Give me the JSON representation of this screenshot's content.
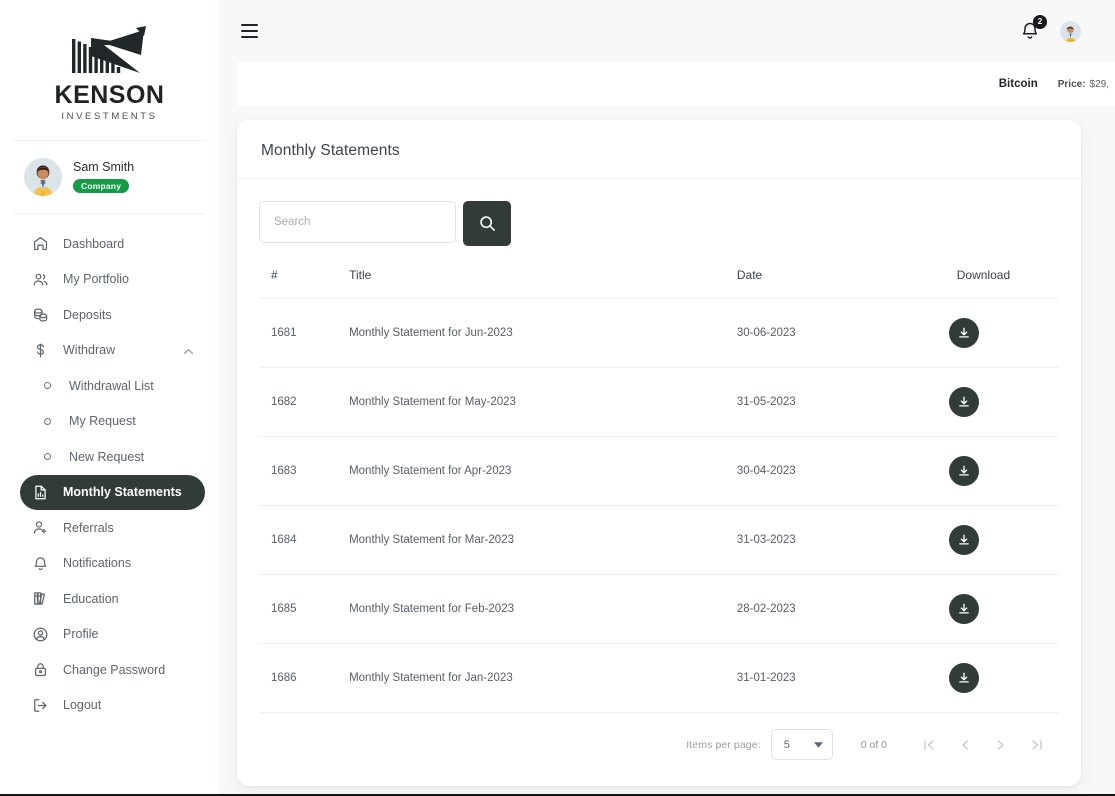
{
  "brand": {
    "name": "KENSON",
    "tagline": "INVESTMENTS",
    "logo_icon": "kenson-arrow-bars-logo"
  },
  "user": {
    "name": "Sam Smith",
    "badge": "Company",
    "badge_color": "#149b45",
    "avatar_icon": "user-avatar"
  },
  "sidebar": {
    "items": [
      {
        "label": "Dashboard",
        "icon": "home-icon",
        "active": false,
        "sub": false
      },
      {
        "label": "My Portfolio",
        "icon": "users-icon",
        "active": false,
        "sub": false
      },
      {
        "label": "Deposits",
        "icon": "coins-icon",
        "active": false,
        "sub": false
      },
      {
        "label": "Withdraw",
        "icon": "dollar-icon",
        "active": false,
        "sub": false,
        "chevron": "chevron-up-icon"
      },
      {
        "label": "Withdrawal List",
        "icon": "bullet-icon",
        "active": false,
        "sub": true
      },
      {
        "label": "My Request",
        "icon": "bullet-icon",
        "active": false,
        "sub": true
      },
      {
        "label": "New Request",
        "icon": "bullet-icon",
        "active": false,
        "sub": true
      },
      {
        "label": "Monthly Statements",
        "icon": "document-chart-icon",
        "active": true,
        "sub": false
      },
      {
        "label": "Referrals",
        "icon": "user-add-icon",
        "active": false,
        "sub": false
      },
      {
        "label": "Notifications",
        "icon": "bell-icon",
        "active": false,
        "sub": false
      },
      {
        "label": "Education",
        "icon": "books-icon",
        "active": false,
        "sub": false
      },
      {
        "label": "Profile",
        "icon": "user-circle-icon",
        "active": false,
        "sub": false
      },
      {
        "label": "Change Password",
        "icon": "lock-icon",
        "active": false,
        "sub": false
      },
      {
        "label": "Logout",
        "icon": "logout-icon",
        "active": false,
        "sub": false
      }
    ],
    "active_color": "#313c39"
  },
  "topbar": {
    "menu_icon": "hamburger-menu-icon",
    "notifications_icon": "bell-icon",
    "notifications_count": "2",
    "avatar_icon": "user-avatar"
  },
  "ticker": {
    "asset": "Bitcoin",
    "price_label": "Price:",
    "price_value": "$29,"
  },
  "page": {
    "title": "Monthly Statements"
  },
  "search": {
    "value": "",
    "placeholder": "Search",
    "button_icon": "search-icon"
  },
  "table": {
    "columns": [
      "#",
      "Title",
      "Date",
      "Download"
    ],
    "download_icon": "download-icon",
    "rows": [
      {
        "id": "1681",
        "title": "Monthly Statement for Jun-2023",
        "date": "30-06-2023"
      },
      {
        "id": "1682",
        "title": "Monthly Statement for May-2023",
        "date": "31-05-2023"
      },
      {
        "id": "1683",
        "title": "Monthly Statement for Apr-2023",
        "date": "30-04-2023"
      },
      {
        "id": "1684",
        "title": "Monthly Statement for Mar-2023",
        "date": "31-03-2023"
      },
      {
        "id": "1685",
        "title": "Monthly Statement for Feb-2023",
        "date": "28-02-2023"
      },
      {
        "id": "1686",
        "title": "Monthly Statement for Jan-2023",
        "date": "31-01-2023"
      }
    ]
  },
  "pagination": {
    "items_per_page_label": "Items per page:",
    "items_per_page_value": "5",
    "range_label": "0 of 0",
    "first_icon": "first-page-icon",
    "prev_icon": "prev-page-icon",
    "next_icon": "next-page-icon",
    "last_icon": "last-page-icon"
  }
}
